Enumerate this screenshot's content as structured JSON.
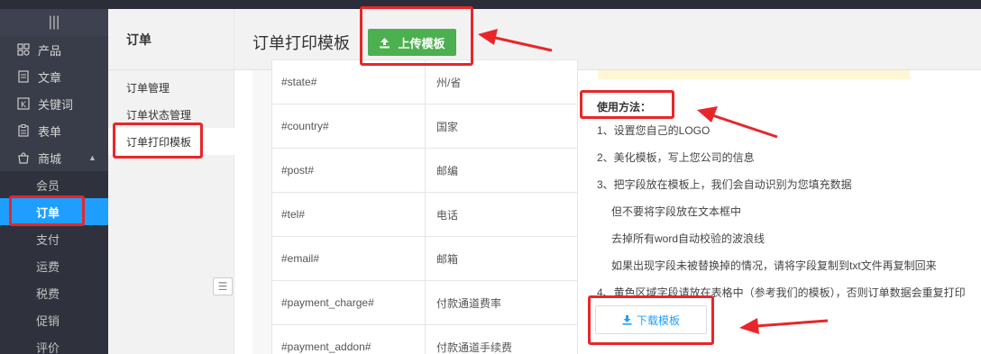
{
  "sidebar": {
    "toggle_icon": "menu-toggle-icon",
    "items": [
      {
        "label": "产品",
        "icon": "grid-icon"
      },
      {
        "label": "文章",
        "icon": "document-icon"
      },
      {
        "label": "关键词",
        "icon": "keyword-icon"
      },
      {
        "label": "表单",
        "icon": "form-icon"
      },
      {
        "label": "商城",
        "icon": "shop-icon"
      }
    ],
    "sub_items": [
      "会员",
      "订单",
      "支付",
      "运费",
      "税费",
      "促销",
      "评价"
    ]
  },
  "subnav": {
    "title": "订单",
    "items": [
      "订单管理",
      "订单状态管理",
      "订单打印模板"
    ]
  },
  "header": {
    "title": "订单打印模板",
    "upload_label": "上传模板"
  },
  "fields": [
    {
      "code": "#state#",
      "desc": "州/省"
    },
    {
      "code": "#country#",
      "desc": "国家"
    },
    {
      "code": "#post#",
      "desc": "邮编"
    },
    {
      "code": "#tel#",
      "desc": "电话"
    },
    {
      "code": "#email#",
      "desc": "邮箱"
    },
    {
      "code": "#payment_charge#",
      "desc": "付款通道费率"
    },
    {
      "code": "#payment_addon#",
      "desc": "付款通道手续费"
    }
  ],
  "instructions": {
    "title": "使用方法：",
    "lines": [
      "1、设置您自己的LOGO",
      "2、美化模板，写上您公司的信息",
      "3、把字段放在模板上，我们会自动识别为您填充数据",
      "但不要将字段放在文本框中",
      "去掉所有word自动校验的波浪线",
      "如果出现字段未被替换掉的情况，请将字段复制到txt文件再复制回来",
      "4、黄色区域字段请放在表格中（参考我们的模板），否则订单数据会重复打印"
    ],
    "download_label": "下载模板"
  },
  "colors": {
    "sidebar_bg": "#393d49",
    "active_blue": "#1E9FFF",
    "upload_green": "#4caf50",
    "annotation_red": "#e8262a"
  }
}
